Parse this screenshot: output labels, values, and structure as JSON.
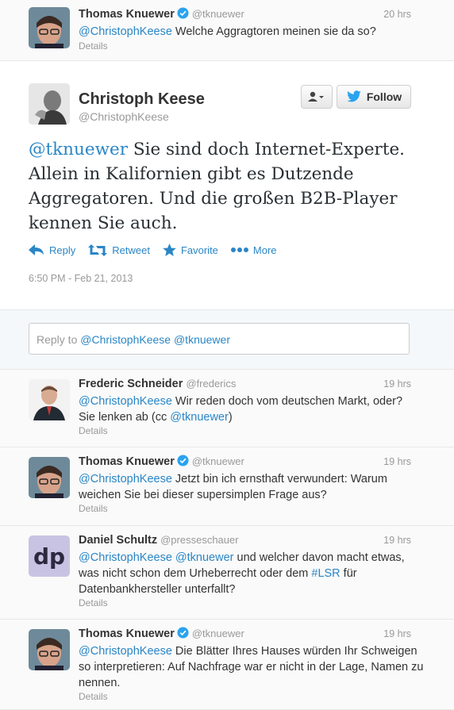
{
  "top_tweet": {
    "fullname": "Thomas Knuewer",
    "username": "@tknuewer",
    "time": "20 hrs",
    "mention": "@ChristophKeese",
    "text": " Welche Aggragtoren meinen sie da so?",
    "details": "Details"
  },
  "main_tweet": {
    "fullname": "Christoph Keese",
    "username": "@ChristophKeese",
    "follow_label": "Follow",
    "body_mention": "@tknuewer",
    "body_text": " Sie sind doch Internet-Experte. Allein in Kalifornien gibt es Dutzende Aggregatoren. Und die großen B2B-Player kennen Sie auch.",
    "actions": {
      "reply": "Reply",
      "retweet": "Retweet",
      "favorite": "Favorite",
      "more": "More"
    },
    "timestamp": "6:50 PM - Feb 21, 2013"
  },
  "reply_box": {
    "prefix": "Reply to ",
    "mentions": "@ChristophKeese @tknuewer"
  },
  "replies": [
    {
      "fullname": "Frederic Schneider",
      "username": "@frederics",
      "time": "19 hrs",
      "m1": "@ChristophKeese",
      "t1": " Wir reden doch vom deutschen Markt, oder? Sie lenken ab (cc ",
      "m2": "@tknuewer",
      "t2": ")",
      "details": "Details"
    },
    {
      "fullname": "Thomas Knuewer",
      "username": "@tknuewer",
      "time": "19 hrs",
      "m1": "@ChristophKeese",
      "t1": " Jetzt bin ich ernsthaft verwundert: Warum weichen Sie bei dieser supersimplen Frage aus?",
      "details": "Details"
    },
    {
      "fullname": "Daniel Schultz",
      "username": "@presseschauer",
      "time": "19 hrs",
      "m1": "@ChristophKeese",
      "m2": " @tknuewer",
      "t1": " und welcher davon macht etwas, was nicht schon dem Urheberrecht oder dem ",
      "m3": "#LSR",
      "t2": " für Datenbankhersteller unterfallt?",
      "details": "Details",
      "avatar_text": "dp"
    },
    {
      "fullname": "Thomas Knuewer",
      "username": "@tknuewer",
      "time": "19 hrs",
      "m1": "@ChristophKeese",
      "t1": " Die Blätter Ihres Hauses würden Ihr Schweigen so interpretieren: Auf Nachfrage war er nicht in der Lage, Namen zu nennen.",
      "details": "Details"
    }
  ],
  "colors": {
    "link": "#2a86c6",
    "verified": "#2aa3ef",
    "muted": "#999999"
  }
}
